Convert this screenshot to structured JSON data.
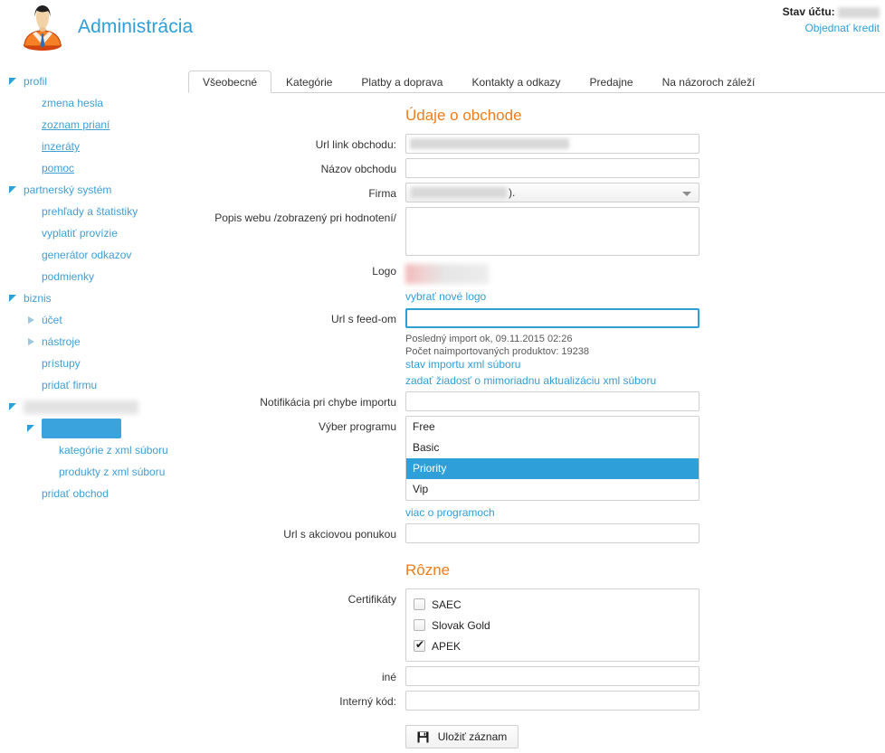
{
  "header": {
    "brand_title": "Administrácia",
    "avatar_icon": "user-avatar-icon",
    "account_status_label": "Stav účtu:",
    "account_status_value": "",
    "order_credit_link": "Objednať kredit"
  },
  "sidebar": {
    "items": [
      {
        "label": "profil",
        "level": 0,
        "marker": "open",
        "underline": false,
        "redacted": false,
        "selected": false
      },
      {
        "label": "zmena hesla",
        "level": 1,
        "marker": "none",
        "underline": false,
        "redacted": false,
        "selected": false
      },
      {
        "label": "zoznam prianí",
        "level": 1,
        "marker": "none",
        "underline": true,
        "redacted": false,
        "selected": false
      },
      {
        "label": "inzeráty",
        "level": 1,
        "marker": "none",
        "underline": true,
        "redacted": false,
        "selected": false
      },
      {
        "label": "pomoc",
        "level": 1,
        "marker": "none",
        "underline": true,
        "redacted": false,
        "selected": false
      },
      {
        "label": "partnerský systém",
        "level": 0,
        "marker": "open",
        "underline": false,
        "redacted": false,
        "selected": false
      },
      {
        "label": "prehľady a štatistiky",
        "level": 1,
        "marker": "none",
        "underline": false,
        "redacted": false,
        "selected": false
      },
      {
        "label": "vyplatiť provízie",
        "level": 1,
        "marker": "none",
        "underline": false,
        "redacted": false,
        "selected": false
      },
      {
        "label": "generátor odkazov",
        "level": 1,
        "marker": "none",
        "underline": false,
        "redacted": false,
        "selected": false
      },
      {
        "label": "podmienky",
        "level": 1,
        "marker": "none",
        "underline": false,
        "redacted": false,
        "selected": false
      },
      {
        "label": "biznis",
        "level": 0,
        "marker": "open",
        "underline": false,
        "redacted": false,
        "selected": false
      },
      {
        "label": "účet",
        "level": 1,
        "marker": "closed",
        "underline": false,
        "redacted": false,
        "selected": false
      },
      {
        "label": "nástroje",
        "level": 1,
        "marker": "closed",
        "underline": false,
        "redacted": false,
        "selected": false
      },
      {
        "label": "prístupy",
        "level": 1,
        "marker": "none",
        "underline": false,
        "redacted": false,
        "selected": false
      },
      {
        "label": "pridať firmu",
        "level": 1,
        "marker": "none",
        "underline": false,
        "redacted": false,
        "selected": false
      },
      {
        "label": "",
        "level": 0,
        "marker": "open",
        "underline": false,
        "redacted": true,
        "redact_width": 127,
        "selected": false
      },
      {
        "label": "",
        "level": 1,
        "marker": "open",
        "underline": false,
        "redacted": false,
        "selected": true,
        "chip_width": 88
      },
      {
        "label": "kategórie z xml súboru",
        "level": 2,
        "marker": "none",
        "underline": false,
        "redacted": false,
        "selected": false
      },
      {
        "label": "produkty z xml súboru",
        "level": 2,
        "marker": "none",
        "underline": false,
        "redacted": false,
        "selected": false
      },
      {
        "label": "pridať obchod",
        "level": 1,
        "marker": "none",
        "underline": false,
        "redacted": false,
        "selected": false
      }
    ]
  },
  "tabs": [
    {
      "label": "Všeobecné",
      "active": true
    },
    {
      "label": "Kategórie",
      "active": false
    },
    {
      "label": "Platby a doprava",
      "active": false
    },
    {
      "label": "Kontakty a odkazy",
      "active": false
    },
    {
      "label": "Predajne",
      "active": false
    },
    {
      "label": "Na názoroch záleží",
      "active": false
    }
  ],
  "form": {
    "section_shop": "Údaje o obchode",
    "section_other": "Rôzne",
    "url_link_label": "Url link obchodu:",
    "url_link_value": "",
    "shop_name_label": "Názov obchodu",
    "shop_name_value": "",
    "company_label": "Firma",
    "company_value": ").",
    "description_label": "Popis webu  /zobrazený pri hodnotení/",
    "description_value": "",
    "logo_label": "Logo",
    "choose_logo_link": "vybrať nové logo",
    "feed_url_label": "Url s feed-om",
    "feed_url_value": "",
    "import_status_line1": "Posledný import ok, 09.11.2015 02:26",
    "import_status_line2": "Počet naimportovaných produktov: 19238",
    "import_status_link": "stav importu xml súboru",
    "request_update_link": "zadať žiadosť o mimoriadnu aktualizáciu xml súboru",
    "import_error_notify_label": "Notifikácia pri chybe importu",
    "import_error_notify_value": "",
    "program_label": "Výber programu",
    "program_options": [
      {
        "label": "Free",
        "selected": false
      },
      {
        "label": "Basic",
        "selected": false
      },
      {
        "label": "Priority",
        "selected": true
      },
      {
        "label": "Vip",
        "selected": false
      }
    ],
    "more_programs_link": "viac o programoch",
    "promo_url_label": "Url s akciovou ponukou",
    "promo_url_value": "",
    "certificates_label": "Certifikáty",
    "certificates": [
      {
        "label": "SAEC",
        "checked": false
      },
      {
        "label": "Slovak Gold",
        "checked": false
      },
      {
        "label": "APEK",
        "checked": true
      }
    ],
    "other_label": "iné",
    "other_value": "",
    "internal_code_label": "Interný kód:",
    "internal_code_value": "",
    "save_label": "Uložiť záznam",
    "save_icon": "floppy-disk-icon"
  },
  "colors": {
    "brand_blue": "#2e9fd8",
    "heading_orange": "#f07d1a",
    "selection_blue": "#2e9fd8",
    "sidebar_selected": "#3aa3dd"
  }
}
